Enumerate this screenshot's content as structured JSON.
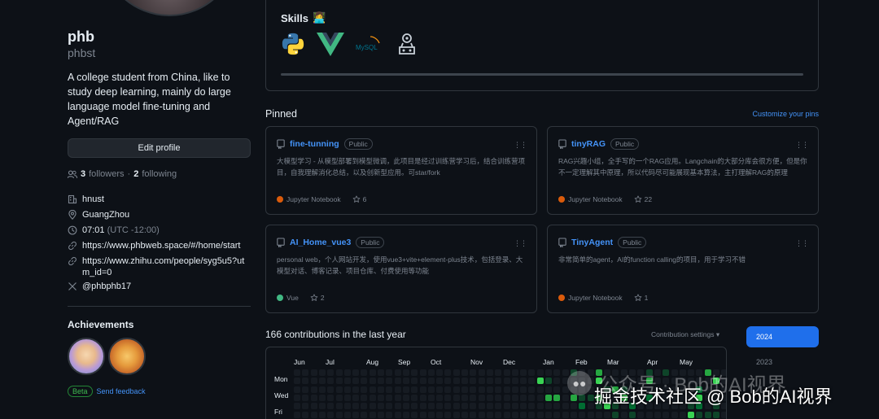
{
  "profile": {
    "name": "phb",
    "login": "phbst",
    "bio": "A college student from China, like to study deep learning, mainly do large language model fine-tuning and Agent/RAG",
    "edit_button": "Edit profile",
    "followers_count": "3",
    "followers_label": "followers",
    "separator": "·",
    "following_count": "2",
    "following_label": "following",
    "organization": "hnust",
    "location": "GuangZhou",
    "local_time": "07:01",
    "timezone": "(UTC -12:00)",
    "website": "https://www.phbweb.space/#/home/start",
    "zhihu_url": "https://www.zhihu.com/people/syg5u5?utm_id=0",
    "x_handle": "@phbphb17"
  },
  "achievements": {
    "title": "Achievements",
    "beta_label": "Beta",
    "feedback_label": "Send feedback"
  },
  "skills": {
    "title": "Skills",
    "title_emoji": "👩‍💻",
    "icons": [
      "python-icon",
      "vue-icon",
      "mysql-icon",
      "agent-icon"
    ],
    "mysql_text": "MySQL"
  },
  "pinned": {
    "title": "Pinned",
    "customize_label": "Customize your pins",
    "repos": [
      {
        "name": "fine-tunning",
        "visibility": "Public",
        "description": "大模型学习 - 从模型部署到模型微调，此项目是经过训练营学习后，结合训练营项目，自我理解消化总结，以及创新型应用。可star/fork",
        "language": "Jupyter Notebook",
        "language_color": "#DA5B0B",
        "stars": "6"
      },
      {
        "name": "tinyRAG",
        "visibility": "Public",
        "description": "RAG兴趣小组，全手写的一个RAG应用。Langchain的大部分库会很方便，但是你不一定理解其中原理，所以代码尽可能展现基本算法，主打理解RAG的原理",
        "language": "Jupyter Notebook",
        "language_color": "#DA5B0B",
        "stars": "22"
      },
      {
        "name": "AI_Home_vue3",
        "visibility": "Public",
        "description": "personal web，个人网站开发，使用vue3+vite+element-plus技术，包括登录、大模型对话、博客记录、项目仓库、付费使用等功能",
        "language": "Vue",
        "language_color": "#41b883",
        "stars": "2"
      },
      {
        "name": "TinyAgent",
        "visibility": "Public",
        "description": "非常简单的agent，AI的function calling的项目，用于学习不错",
        "language": "Jupyter Notebook",
        "language_color": "#DA5B0B",
        "stars": "1"
      }
    ]
  },
  "contributions": {
    "title": "166 contributions in the last year",
    "settings_label": "Contribution settings ▾",
    "months": [
      "Jun",
      "Jul",
      "Aug",
      "Sep",
      "Oct",
      "Nov",
      "Dec",
      "Jan",
      "Feb",
      "Mar",
      "Apr",
      "May"
    ],
    "days": [
      "Mon",
      "Wed",
      "Fri"
    ],
    "years": [
      "2024",
      "2023"
    ],
    "colors": [
      "#161b22",
      "#0e4429",
      "#006d32",
      "#26a641",
      "#39d353"
    ]
  },
  "watermark": {
    "top": "公众号 · Bob的AI视界",
    "bottom": "掘金技术社区 @ Bob的AI视界"
  }
}
